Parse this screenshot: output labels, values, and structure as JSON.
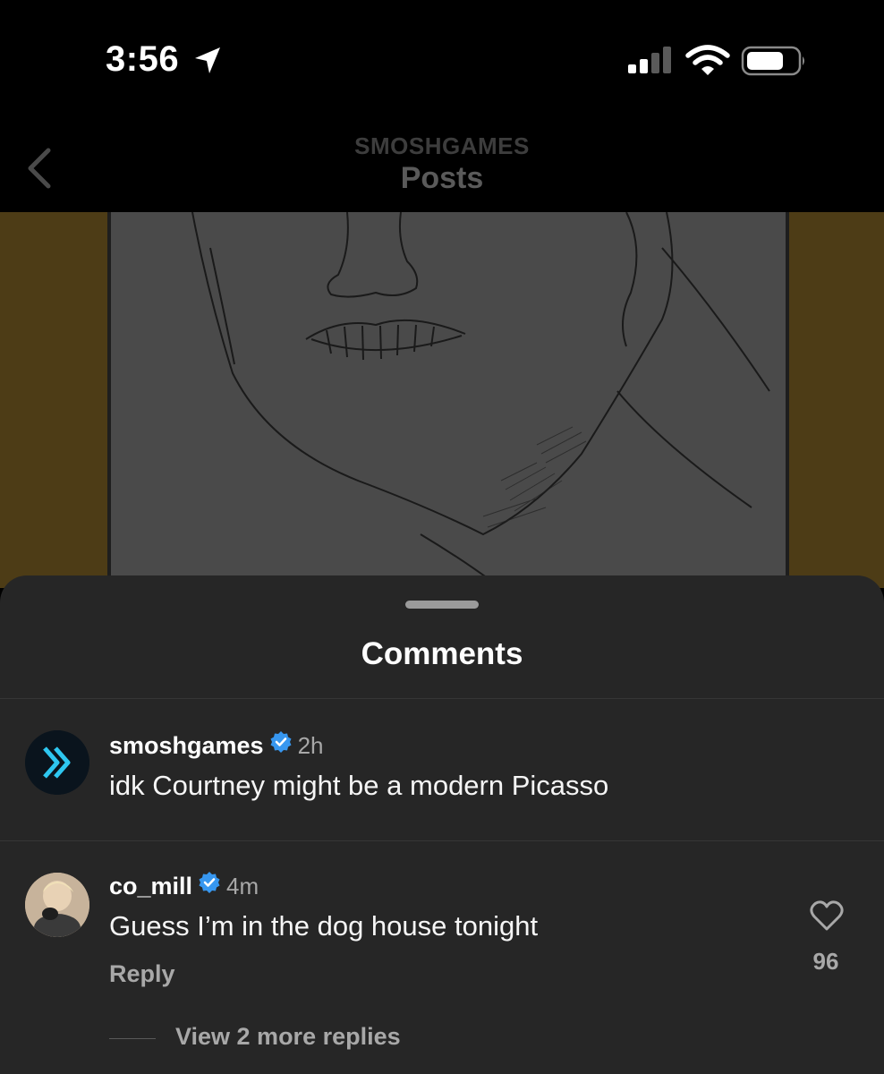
{
  "status_bar": {
    "time": "3:56",
    "location_icon": "location-arrow-icon",
    "signal_icon": "cellular-signal-icon",
    "wifi_icon": "wifi-icon",
    "battery_icon": "battery-icon"
  },
  "header": {
    "subtitle": "SMOSHGAMES",
    "title": "Posts",
    "back_icon": "chevron-left-icon"
  },
  "comments_sheet": {
    "title": "Comments",
    "comments": [
      {
        "username": "smoshgames",
        "verified": true,
        "time": "2h",
        "text": "idk Courtney might be a modern Picasso"
      },
      {
        "username": "co_mill",
        "verified": true,
        "time": "4m",
        "text": "Guess I’m in the dog house tonight",
        "reply_label": "Reply",
        "like_count": "96",
        "view_replies_label": "View 2 more replies"
      }
    ]
  },
  "colors": {
    "sheet_background": "#262626",
    "verified_badge": "#3797f0",
    "secondary_text": "#a8a8a8",
    "post_background": "#4d3c16"
  }
}
